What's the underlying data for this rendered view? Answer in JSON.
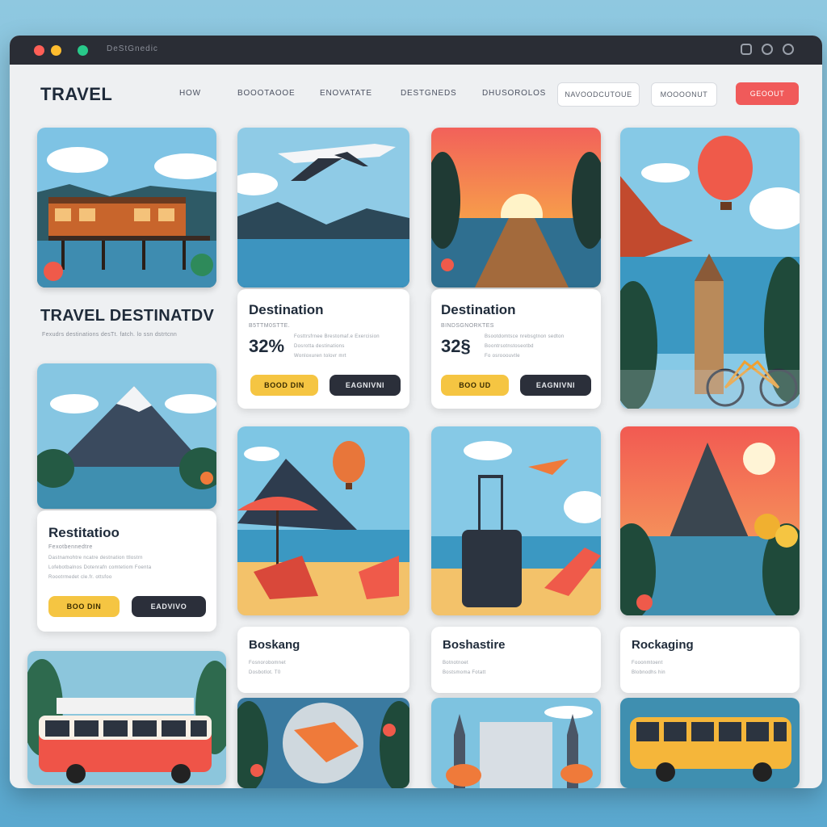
{
  "window": {
    "title": "DeStGnedic"
  },
  "nav": {
    "logo": "TRAVEL",
    "links": [
      "HOW",
      "BOOOTAOOE",
      "ENOVATATE",
      "DESTGNEDS",
      "DHUSOROLOS"
    ],
    "outline_buttons": [
      "NAVOODCUTOUE",
      "MOOOONUT"
    ],
    "cta_button": "GEOOUT"
  },
  "hero": {
    "title": "TRAVEL DESTINATDV",
    "subtitle": "Fexudrs destinations desTt. fatch. lo ssn dstrtcnn"
  },
  "dest_cards": [
    {
      "title": "Destination",
      "subtitle": "B5TTM0STTE.",
      "price": "32%",
      "lines": [
        "Fosttrsfrnee Brestomaf.e Exercision",
        "Dosrotta destinations",
        "Wonloxuren tolovr mrt"
      ],
      "book": "BOOD DIN",
      "more": "EAGNIVNI"
    },
    {
      "title": "Destination",
      "subtitle": "BINDSGNORKTES",
      "price": "32§",
      "lines": [
        "Bsootdomtsce nrebsgtnon sedton",
        "Boontrsotnstoseotbd",
        "Fo osrooouvtle"
      ],
      "book": "BOO UD",
      "more": "EAGNIVNI"
    }
  ],
  "left_panel": {
    "title": "Restitatioo",
    "subtitle": "Fexotbennedtre",
    "lines": [
      "Dastnamohtre ncatre destnation ttlostrn",
      "Lofebotbalnos Dotenrafn comtetiom Foenta",
      "Roootrmedet cle.fr. ottsfoo"
    ],
    "book": "BOO DIN",
    "more": "EADVIVO"
  },
  "booking_cards": [
    {
      "title": "Boskang",
      "lines": [
        "Fosnorobomnet",
        "Dosbotlot. T0"
      ]
    },
    {
      "title": "Boshastire",
      "lines": [
        "Botnotnoet",
        "Bostsmoma Fotatt"
      ]
    },
    {
      "title": "Rockaging",
      "lines": [
        "Fooonmtoent",
        "Blobnodhs hin"
      ]
    }
  ],
  "colors": {
    "accent_yellow": "#f5c542",
    "accent_red": "#f05a5a",
    "dark": "#2b2f3a"
  }
}
